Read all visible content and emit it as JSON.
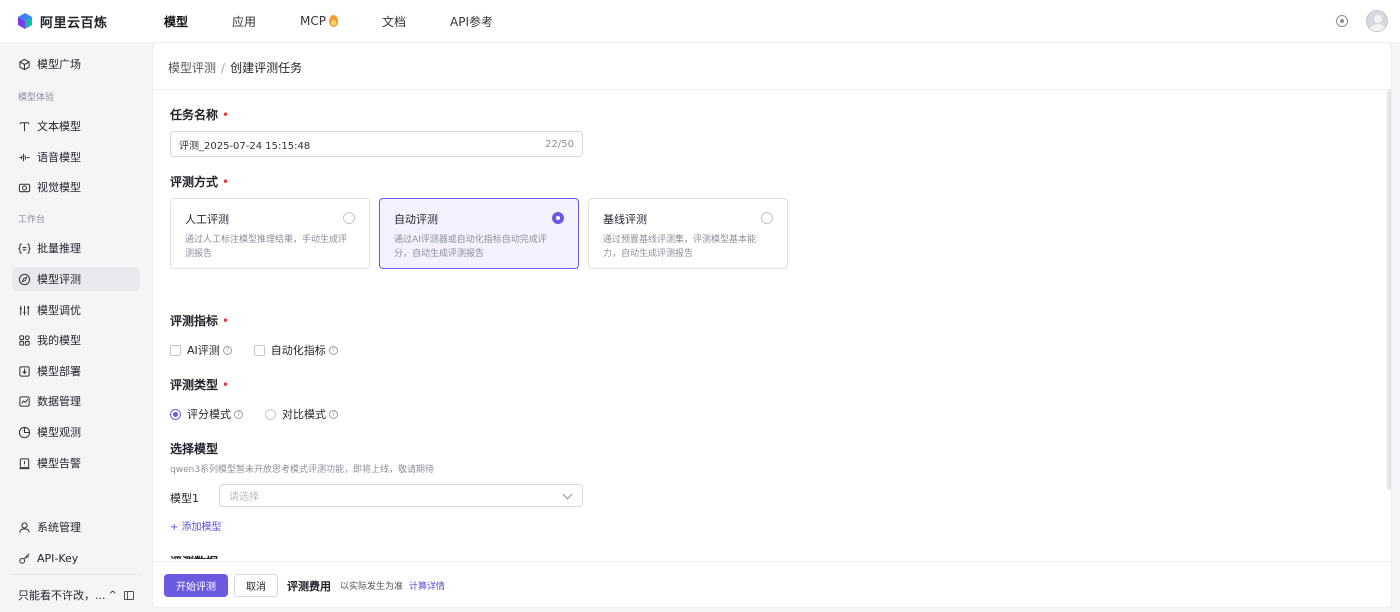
{
  "app": {
    "logo_text": "阿里云百炼"
  },
  "topnav": {
    "items": [
      {
        "label": "模型",
        "active": true
      },
      {
        "label": "应用"
      },
      {
        "label": "MCP"
      },
      {
        "label": "文档"
      },
      {
        "label": "API参考"
      }
    ]
  },
  "sidebar": {
    "items": [
      {
        "label": "模型广场",
        "icon": "cube-icon"
      },
      {
        "label": "文本模型",
        "icon": "text-icon"
      },
      {
        "label": "语音模型",
        "icon": "waveform-icon"
      },
      {
        "label": "视觉模型",
        "icon": "camera-icon"
      },
      {
        "label": "批量推理",
        "icon": "brackets-icon"
      },
      {
        "label": "模型评测",
        "icon": "compass-icon",
        "active": true
      },
      {
        "label": "模型调优",
        "icon": "sliders-icon"
      },
      {
        "label": "我的模型",
        "icon": "grid-icon"
      },
      {
        "label": "模型部署",
        "icon": "deploy-icon"
      },
      {
        "label": "数据管理",
        "icon": "chart-icon"
      },
      {
        "label": "模型观测",
        "icon": "pie-icon"
      },
      {
        "label": "模型告警",
        "icon": "alert-icon"
      },
      {
        "label": "系统管理",
        "icon": "user-icon"
      },
      {
        "label": "API-Key",
        "icon": "key-icon"
      }
    ],
    "groups": {
      "experience": "模型体验",
      "workbench": "工作台"
    },
    "footer_label": "只能看不许改，..."
  },
  "breadcrumb": {
    "parent": "模型评测",
    "separator": "/",
    "current": "创建评测任务"
  },
  "form": {
    "task_name": {
      "label": "任务名称",
      "value": "评测_2025-07-24 15:15:48",
      "count": "22/50"
    },
    "method": {
      "label": "评测方式",
      "options": [
        {
          "title": "人工评测",
          "desc": "通过人工标注模型推理结果，手动生成评测报告",
          "selected": false
        },
        {
          "title": "自动评测",
          "desc": "通过AI评测器或自动化指标自动完成评分，自动生成评测报告",
          "selected": true
        },
        {
          "title": "基线评测",
          "desc": "通过预置基线评测集，评测模型基本能力，自动生成评测报告",
          "selected": false
        }
      ]
    },
    "metrics": {
      "label": "评测指标",
      "options": [
        "AI评测",
        "自动化指标"
      ]
    },
    "eval_type": {
      "label": "评测类型",
      "options": [
        "评分模式",
        "对比模式"
      ],
      "selected": "评分模式"
    },
    "model_select": {
      "label": "选择模型",
      "hint": "qwen3系列模型暂未开放思考模式评测功能，即将上线，敬请期待",
      "model1_label": "模型1",
      "placeholder": "请选择",
      "add_label": "+ 添加模型"
    },
    "data_label": "评测数据"
  },
  "footer": {
    "start_label": "开始评测",
    "cancel_label": "取消",
    "fee_title": "评测费用",
    "fee_note": "以实际发生为准",
    "fee_link": "计算详情"
  },
  "colors": {
    "accent": "#6a5ae0",
    "required": "#e23c3c",
    "link": "#5a4fd6"
  }
}
